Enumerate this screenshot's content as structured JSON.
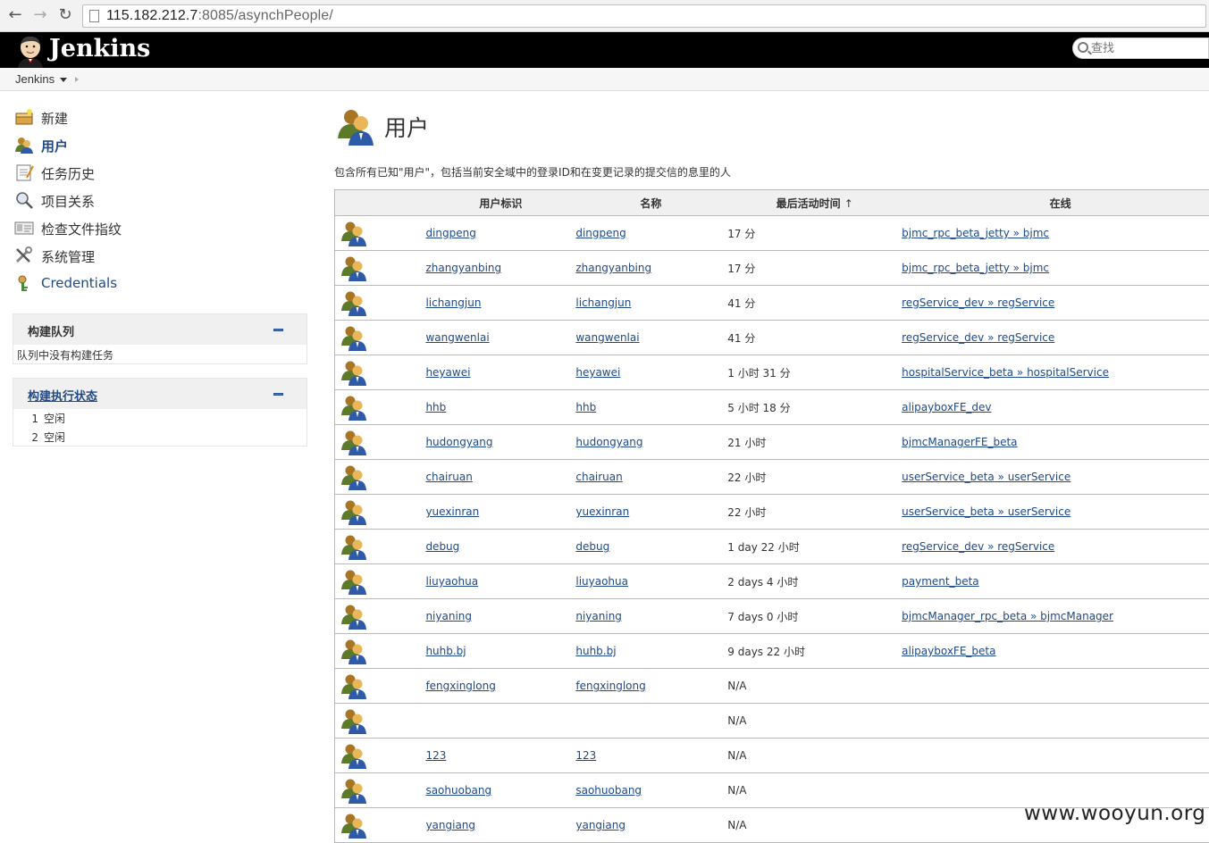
{
  "browser": {
    "url_host": "115.182.212.7",
    "url_rest": ":8085/asynchPeople/"
  },
  "header": {
    "title": "Jenkins",
    "search_placeholder": "查找"
  },
  "breadcrumb": {
    "root": "Jenkins"
  },
  "sidebar": {
    "tasks": [
      {
        "label": "新建",
        "icon": "new-job-icon"
      },
      {
        "label": "用户",
        "icon": "users-icon",
        "active": true
      },
      {
        "label": "任务历史",
        "icon": "history-icon"
      },
      {
        "label": "项目关系",
        "icon": "search-icon"
      },
      {
        "label": "检查文件指纹",
        "icon": "fingerprint-icon"
      },
      {
        "label": "系统管理",
        "icon": "tools-icon"
      },
      {
        "label": "Credentials",
        "icon": "credentials-icon"
      }
    ],
    "build_queue": {
      "title": "构建队列",
      "empty_text": "队列中没有构建任务"
    },
    "executors": {
      "title": "构建执行状态",
      "items": [
        {
          "num": "1",
          "status": "空闲"
        },
        {
          "num": "2",
          "status": "空闲"
        }
      ]
    }
  },
  "main": {
    "title": "用户",
    "description": "包含所有已知\"用户\"，包括当前安全域中的登录ID和在变更记录的提交信的息里的人",
    "columns": {
      "user_id": "用户标识",
      "name": "名称",
      "last_active": "最后活动时间",
      "sort_arrow": "↑",
      "online": "在线"
    },
    "users": [
      {
        "id": "dingpeng",
        "name": "dingpeng",
        "time": "17 分",
        "online": "bjmc_rpc_beta_jetty » bjmc"
      },
      {
        "id": "zhangyanbing",
        "name": "zhangyanbing",
        "time": "17 分",
        "online": "bjmc_rpc_beta_jetty » bjmc"
      },
      {
        "id": "lichangjun",
        "name": "lichangjun",
        "time": "41 分",
        "online": "regService_dev » regService"
      },
      {
        "id": "wangwenlai",
        "name": "wangwenlai",
        "time": "41 分",
        "online": "regService_dev » regService"
      },
      {
        "id": "heyawei",
        "name": "heyawei",
        "time": "1 小时 31 分",
        "online": "hospitalService_beta » hospitalService"
      },
      {
        "id": "hhb",
        "name": "hhb",
        "time": "5 小时 18 分",
        "online": "alipayboxFE_dev"
      },
      {
        "id": "hudongyang",
        "name": "hudongyang",
        "time": "21 小时",
        "online": "bjmcManagerFE_beta"
      },
      {
        "id": "chairuan",
        "name": "chairuan",
        "time": "22 小时",
        "online": "userService_beta » userService"
      },
      {
        "id": "yuexinran",
        "name": "yuexinran",
        "time": "22 小时",
        "online": "userService_beta » userService"
      },
      {
        "id": "debug",
        "name": "debug",
        "time": "1 day 22 小时",
        "online": "regService_dev » regService"
      },
      {
        "id": "liuyaohua",
        "name": "liuyaohua",
        "time": "2 days 4 小时",
        "online": "payment_beta"
      },
      {
        "id": "niyaning",
        "name": "niyaning",
        "time": "7 days 0 小时",
        "online": "bjmcManager_rpc_beta » bjmcManager"
      },
      {
        "id": "huhb.bj",
        "name": "huhb.bj",
        "time": "9 days 22 小时",
        "online": "alipayboxFE_beta"
      },
      {
        "id": "fengxinglong",
        "name": "fengxinglong",
        "time": "N/A",
        "online": ""
      },
      {
        "id": "",
        "name": "",
        "time": "N/A",
        "online": ""
      },
      {
        "id": "123",
        "name": "123",
        "time": "N/A",
        "online": ""
      },
      {
        "id": "saohuobang",
        "name": "saohuobang",
        "time": "N/A",
        "online": ""
      },
      {
        "id": "yangiang",
        "name": "yangiang",
        "time": "N/A",
        "online": ""
      }
    ]
  },
  "watermark": "www.wooyun.org"
}
